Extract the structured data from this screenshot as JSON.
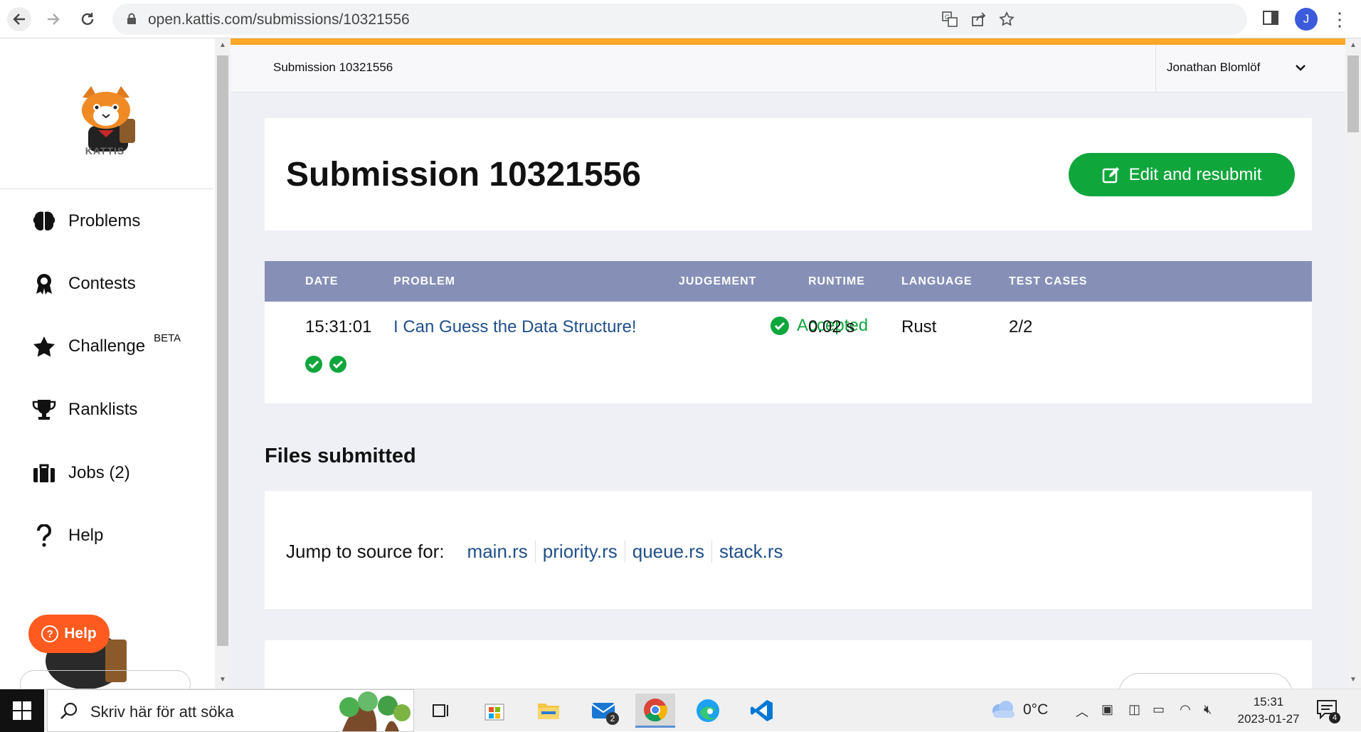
{
  "browser": {
    "url": "open.kattis.com/submissions/10321556",
    "profile_initial": "J"
  },
  "sidebar": {
    "logo_text": "KATTIS",
    "items": [
      {
        "label": "Problems",
        "icon": "brain-icon"
      },
      {
        "label": "Contests",
        "icon": "award-icon"
      },
      {
        "label": "Challenge",
        "icon": "star-icon",
        "badge": "BETA"
      },
      {
        "label": "Ranklists",
        "icon": "trophy-icon"
      },
      {
        "label": "Jobs (2)",
        "icon": "briefcase-icon"
      },
      {
        "label": "Help",
        "icon": "question-icon"
      }
    ],
    "help_button": "Help"
  },
  "topbar": {
    "breadcrumb": "Submission 10321556",
    "user": "Jonathan Blomlöf"
  },
  "page": {
    "title": "Submission 10321556",
    "edit_button": "Edit and resubmit"
  },
  "table": {
    "headers": [
      "DATE",
      "PROBLEM",
      "JUDGEMENT",
      "RUNTIME",
      "LANGUAGE",
      "TEST CASES"
    ],
    "row": {
      "date": "15:31:01",
      "problem": "I Can Guess the Data Structure!",
      "judgement": "Accepted",
      "runtime": "0.02 s",
      "language": "Rust",
      "test_cases": "2/2"
    },
    "test_case_results": [
      "accepted",
      "accepted"
    ]
  },
  "files": {
    "heading": "Files submitted",
    "jump_label": "Jump to source for:",
    "links": [
      "main.rs",
      "priority.rs",
      "queue.rs",
      "stack.rs"
    ]
  },
  "taskbar": {
    "search_placeholder": "Skriv här för att söka",
    "mail_badge": "2",
    "weather": "0°C",
    "time": "15:31",
    "date": "2023-01-27",
    "notification_count": "4"
  },
  "colors": {
    "accent_orange": "#ffa726",
    "success_green": "#0fa63c",
    "table_header": "#8690b7",
    "link_blue": "#1f4f8a",
    "help_orange": "#ff5a1f"
  }
}
